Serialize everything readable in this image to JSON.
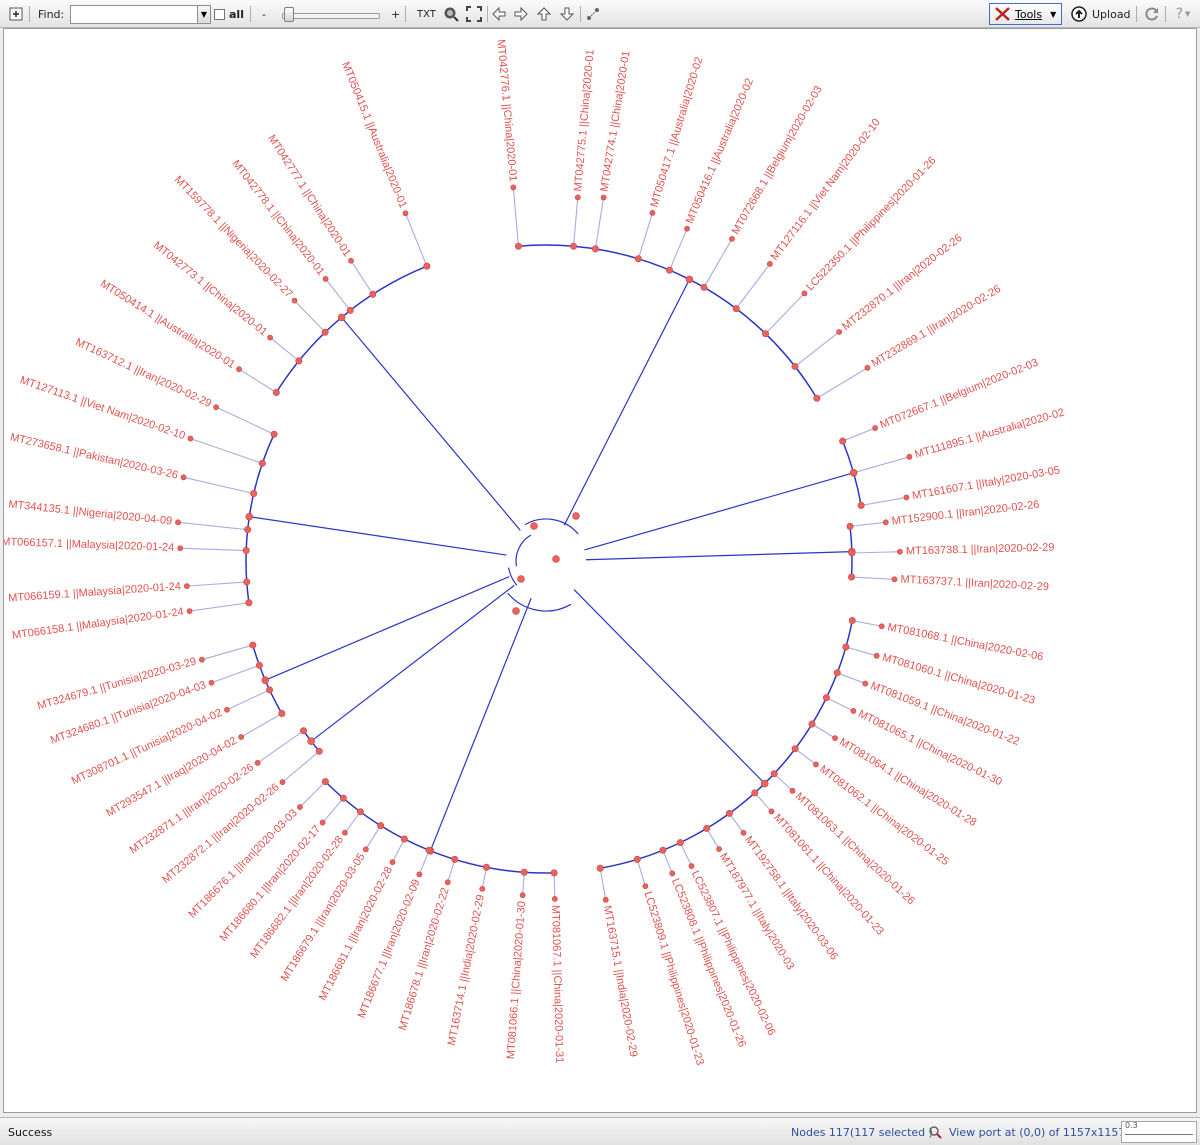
{
  "toolbar": {
    "find_label": "Find:",
    "find_value": "",
    "all_label": "all",
    "zoom_minus": "-",
    "zoom_plus": "+",
    "txt_label": "TXT",
    "tools_label": "Tools",
    "upload_label": "Upload"
  },
  "status": {
    "message": "Success",
    "nodes": "Nodes 117(117 selected )",
    "viewport": "View port at (0,0)  of 1157x1157",
    "zoom_value": "0.3"
  },
  "colors": {
    "branch": "#2a35c8",
    "branch_light": "#a7addf",
    "leaf_label": "#e0524f",
    "node": "#e8625e"
  },
  "tree": {
    "leaves": [
      "MT042776.1 ||China|2020-01",
      "MT042775.1 ||China|2020-01",
      "MT042774.1 ||China|2020-01",
      "MT050417.1 ||Australia|2020-02",
      "MT050416.1 ||Australia|2020-02",
      "MT072668.1 ||Belgium|2020-02-03",
      "MT127116.1 ||Viet Nam|2020-02-10",
      "LC522350.1 ||Philippines|2020-01-26",
      "MT232870.1 ||Iran|2020-02-26",
      "MT232869.1 ||Iran|2020-02-26",
      "MT072667.1 ||Belgium|2020-02-03",
      "MT111895.1 ||Australia|2020-02",
      "MT161607.1 ||Italy|2020-03-05",
      "MT152900.1 ||Iran|2020-02-26",
      "MT163738.1 ||Iran|2020-02-29",
      "MT163737.1 ||Iran|2020-02-29",
      "MT081068.1 ||China|2020-02-06",
      "MT081060.1 ||China|2020-01-23",
      "MT081059.1 ||China|2020-01-22",
      "MT081065.1 ||China|2020-01-30",
      "MT081064.1 ||China|2020-01-28",
      "MT081062.1 ||China|2020-01-25",
      "MT081063.1 ||China|2020-01-26",
      "MT081061.1 ||China|2020-01-23",
      "MT192758.1 ||Italy|2020-03-06",
      "MT187977.1 ||Italy|2020-03",
      "LC523807.1 ||Philippines|2020-02-06",
      "LC523808.1 ||Philippines|2020-01-26",
      "LC523809.1 ||Philippines|2020-01-23",
      "MT163715.1 ||India|2020-02-29",
      "MT081067.1 ||China|2020-01-31",
      "MT081066.1 ||China|2020-01-30",
      "MT163714.1 ||India|2020-02-29",
      "MT186678.1 ||Iran|2020-02-22",
      "MT186677.1 ||Iran|2020-02-09",
      "MT186681.1 ||Iran|2020-02-28",
      "MT186679.1 ||Iran|2020-03-05",
      "MT186682.1 ||Iran|2020-02-28",
      "MT186680.1 ||Iran|2020-02-17",
      "MT186676.1 ||Iran|2020-03-03",
      "MT232872.1 ||Iran|2020-02-26",
      "MT232871.1 ||Iran|2020-02-26",
      "MT293547.1 ||Iraq|2020-04-02",
      "MT308701.1 ||Tunisia|2020-04-02",
      "MT324680.1 ||Tunisia|2020-04-03",
      "MT324679.1 ||Tunisia|2020-03-29",
      "MT066158.1 ||Malaysia|2020-01-24",
      "MT066159.1 ||Malaysia|2020-01-24",
      "MT066157.1 ||Malaysia|2020-01-24",
      "MT344135.1 ||Nigeria|2020-04-09",
      "MT273658.1 ||Pakistan|2020-03-26",
      "MT127113.1 ||Viet Nam|2020-02-10",
      "MT163712.1 ||Iran|2020-02-29",
      "MT050414.1 ||Australia|2020-01",
      "MT042773.1 ||China|2020-01",
      "MT159778.1 ||Nigeria|2020-02-27",
      "MT042778.1 ||China|2020-01",
      "MT042777.1 ||China|2020-01",
      "MT050415.1 ||Australia|2020-01"
    ]
  }
}
